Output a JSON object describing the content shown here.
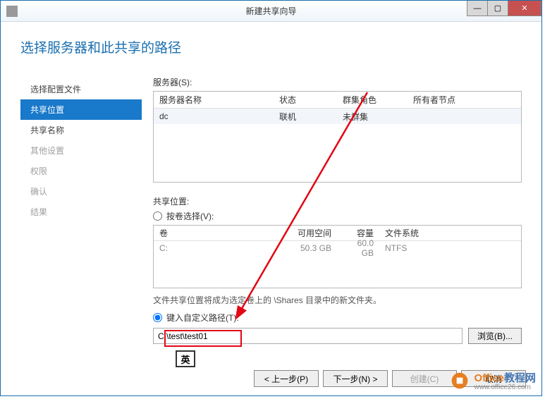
{
  "titlebar": {
    "title": "新建共享向导"
  },
  "page_title": "选择服务器和此共享的路径",
  "sidebar": {
    "items": [
      {
        "label": "选择配置文件",
        "state": "done"
      },
      {
        "label": "共享位置",
        "state": "active"
      },
      {
        "label": "共享名称",
        "state": "done"
      },
      {
        "label": "其他设置",
        "state": "disabled"
      },
      {
        "label": "权限",
        "state": "disabled"
      },
      {
        "label": "确认",
        "state": "disabled"
      },
      {
        "label": "结果",
        "state": "disabled"
      }
    ]
  },
  "servers": {
    "label": "服务器(S):",
    "headers": {
      "name": "服务器名称",
      "status": "状态",
      "role": "群集角色",
      "owner": "所有者节点"
    },
    "rows": [
      {
        "name": "dc",
        "status": "联机",
        "role": "未群集",
        "owner": ""
      }
    ]
  },
  "share_location": {
    "label": "共享位置:",
    "by_volume_label": "按卷选择(V):",
    "volume_headers": {
      "vol": "卷",
      "free": "可用空间",
      "cap": "容量",
      "fs": "文件系统"
    },
    "volume_rows": [
      {
        "vol": "C:",
        "free": "50.3 GB",
        "cap": "60.0 GB",
        "fs": "NTFS"
      }
    ],
    "helper": "文件共享位置将成为选定卷上的 \\Shares 目录中的新文件夹。",
    "custom_path_label": "键入自定义路径(T):",
    "path_value": "C:\\test\\test01",
    "browse_label": "浏览(B)..."
  },
  "ime_indicator": "英",
  "footer": {
    "prev": "< 上一步(P)",
    "next": "下一步(N) >",
    "create": "创建(C)",
    "cancel": "取消"
  },
  "watermark": {
    "brand1": "Office",
    "brand2": "教程网",
    "url": "www.office26.com"
  }
}
